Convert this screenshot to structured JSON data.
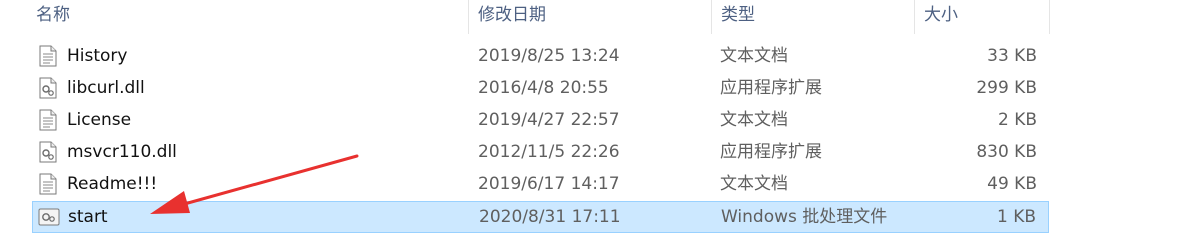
{
  "columns": {
    "name": "名称",
    "modified": "修改日期",
    "type": "类型",
    "size": "大小"
  },
  "files": [
    {
      "name": "History",
      "modified": "2019/8/25 13:24",
      "type": "文本文档",
      "size": "33 KB",
      "icon": "text-file-icon"
    },
    {
      "name": "libcurl.dll",
      "modified": "2016/4/8 20:55",
      "type": "应用程序扩展",
      "size": "299 KB",
      "icon": "dll-file-icon"
    },
    {
      "name": "License",
      "modified": "2019/4/27 22:57",
      "type": "文本文档",
      "size": "2 KB",
      "icon": "text-file-icon"
    },
    {
      "name": "msvcr110.dll",
      "modified": "2012/11/5 22:26",
      "type": "应用程序扩展",
      "size": "830 KB",
      "icon": "dll-file-icon"
    },
    {
      "name": "Readme!!!",
      "modified": "2019/6/17 14:17",
      "type": "文本文档",
      "size": "49 KB",
      "icon": "text-file-icon"
    },
    {
      "name": "start",
      "modified": "2020/8/31 17:11",
      "type": "Windows 批处理文件",
      "size": "1 KB",
      "icon": "batch-file-icon",
      "selected": true
    }
  ],
  "colors": {
    "selection_bg": "#cce8ff",
    "selection_border": "#99d1ff",
    "annotation_arrow": "#e8312f"
  }
}
